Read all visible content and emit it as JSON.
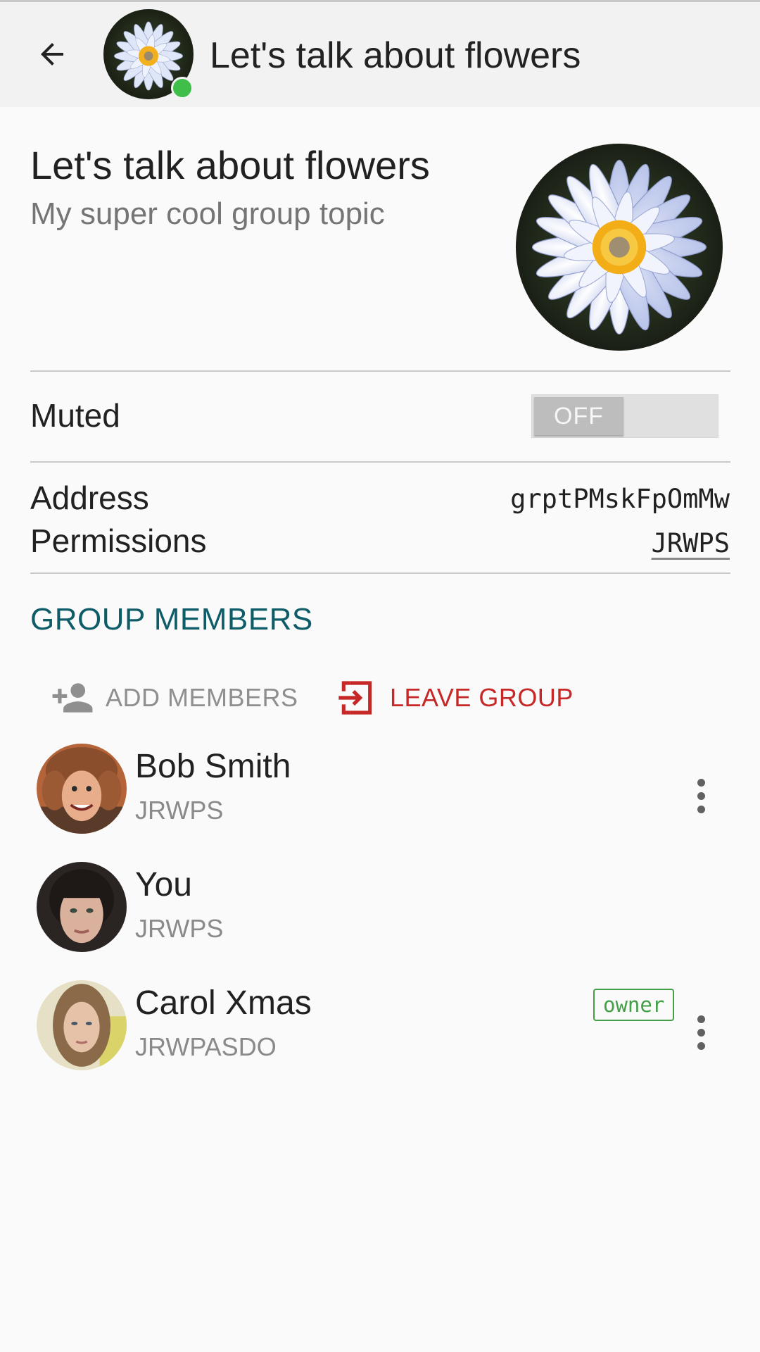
{
  "toolbar": {
    "back_icon": "arrow-back-icon",
    "title": "Let's talk about flowers",
    "online": true,
    "online_color": "#3fbf4a"
  },
  "group": {
    "name": "Let's talk about flowers",
    "topic": "My super cool group topic",
    "avatar": "water-lily-photo"
  },
  "muted": {
    "label": "Muted",
    "toggle_text": "OFF",
    "value": false
  },
  "address": {
    "label": "Address",
    "value": "grptPMskFpOmMw"
  },
  "permissions": {
    "label": "Permissions",
    "value": "JRWPS"
  },
  "members_section": {
    "title": "GROUP MEMBERS",
    "title_color": "#0f5c69",
    "add_label": "ADD MEMBERS",
    "add_icon": "person-add-icon",
    "leave_label": "LEAVE GROUP",
    "leave_icon": "exit-icon",
    "leave_color": "#c62828"
  },
  "members": [
    {
      "name": "Bob Smith",
      "permissions": "JRWPS",
      "avatar": "bob-smith-photo",
      "has_menu": true,
      "badge": ""
    },
    {
      "name": "You",
      "permissions": "JRWPS",
      "avatar": "you-photo",
      "has_menu": false,
      "badge": ""
    },
    {
      "name": "Carol Xmas",
      "permissions": "JRWPASDO",
      "avatar": "carol-xmas-photo",
      "has_menu": true,
      "badge": "owner"
    }
  ]
}
